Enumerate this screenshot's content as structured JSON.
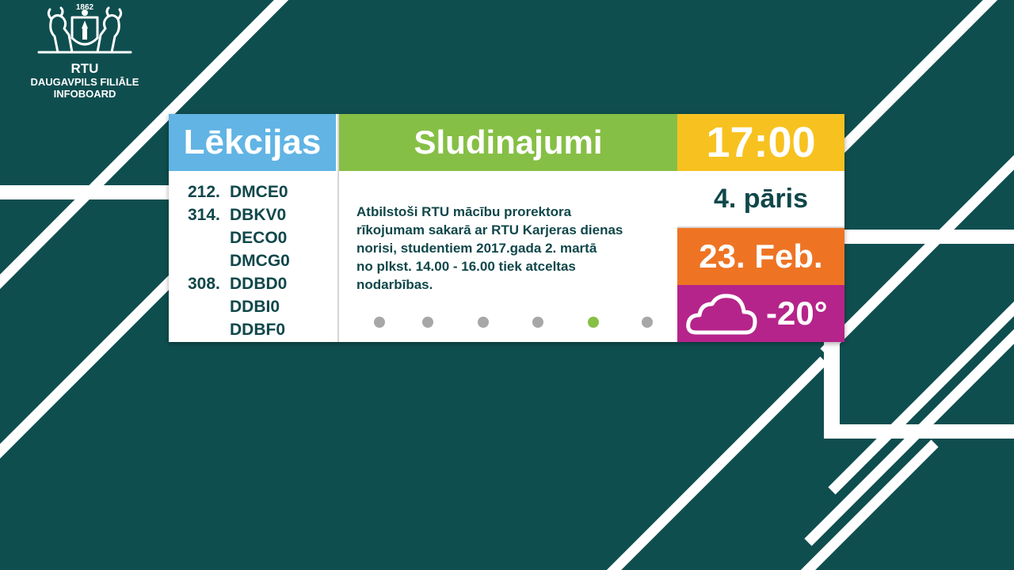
{
  "logo": {
    "year": "1862",
    "name": "RTU",
    "branch": "DAUGAVPILS FILIĀLE",
    "board": "INFOBOARD",
    "icon": "rtu-crest-icon"
  },
  "lectures": {
    "title": "Lēkcijas",
    "rows": [
      {
        "room": "212.",
        "group": "DMCE0"
      },
      {
        "room": "314.",
        "group": "DBKV0"
      },
      {
        "room": "",
        "group": "DECO0"
      },
      {
        "room": "",
        "group": "DMCG0"
      },
      {
        "room": "308.",
        "group": "DDBD0"
      },
      {
        "room": "",
        "group": "DDBI0"
      },
      {
        "room": "",
        "group": "DDBF0"
      }
    ]
  },
  "ads": {
    "title": "Sludinajumi",
    "lines": [
      "Atbilstoši RTU mācību prorektora",
      "rīkojumam sakarā ar RTU Karjeras dienas",
      "norisi, studentiem 2017.gada 2. martā",
      "no plkst. 14.00 - 16.00 tiek atceltas",
      "nodarbības."
    ],
    "slide_count": 6,
    "active_slide": 5
  },
  "info": {
    "time": "17:00",
    "pair": "4. pāris",
    "date": "23. Feb.",
    "weather_icon": "cloud-icon",
    "temperature": "-20°"
  },
  "colors": {
    "background": "#0f4e4f",
    "lectures": "#61b4e4",
    "ads": "#86bf45",
    "time": "#f7c21f",
    "date": "#ee7424",
    "weather": "#b5248a",
    "text_dark": "#10474a"
  }
}
